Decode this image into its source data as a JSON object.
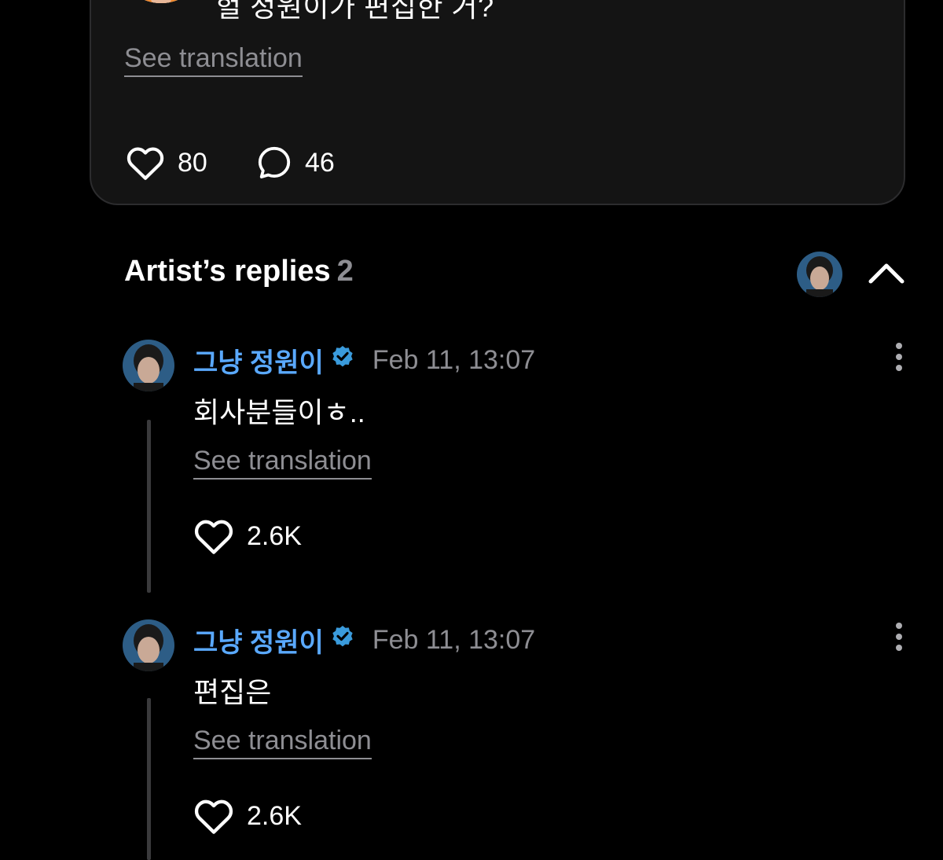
{
  "post": {
    "text": "헐 정원이가 편집한 거?",
    "see_translation": "See translation",
    "likes": "80",
    "comments": "46"
  },
  "replies_header": {
    "title": "Artist’s replies",
    "count": "2"
  },
  "replies": [
    {
      "author": "그냥 정원이",
      "time": "Feb 11, 13:07",
      "text": "회사분들이ㅎ..",
      "see_translation": "See translation",
      "likes": "2.6K"
    },
    {
      "author": "그냥 정원이",
      "time": "Feb 11, 13:07",
      "text": "편집은",
      "see_translation": "See translation",
      "likes": "2.6K"
    }
  ],
  "icons": {
    "like": "heart-outline-icon",
    "comment": "speech-bubble-icon",
    "verified": "verified-badge-icon",
    "collapse": "chevron-up-icon",
    "more": "vertical-ellipsis-icon"
  },
  "colors": {
    "background": "#000000",
    "card": "#141414",
    "card_border": "#2c2c2e",
    "author": "#5aa9ff",
    "verified": "#3a9bdc",
    "muted": "#8e8e93",
    "thread_line": "#3a3a3c"
  }
}
